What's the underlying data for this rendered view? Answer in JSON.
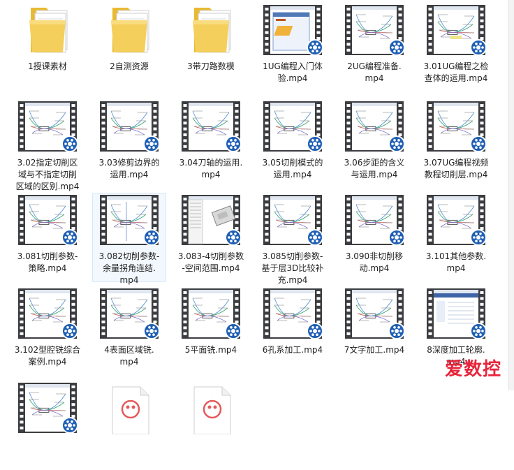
{
  "files": [
    {
      "label": "1授课素材",
      "kind": "folder"
    },
    {
      "label": "2自测资源",
      "kind": "folder"
    },
    {
      "label": "3带刀路数模",
      "kind": "folder"
    },
    {
      "label": "1UG编程入门体\n验.mp4",
      "kind": "video",
      "preview": "dialog"
    },
    {
      "label": "2UG编程准备.\nmp4",
      "kind": "video",
      "preview": "mindmap"
    },
    {
      "label": "3.01UG编程之检\n查体的运用.mp4",
      "kind": "video",
      "preview": "mindmap-light"
    },
    {
      "label": "3.02指定切削区\n域与不指定切削\n区域的区别.mp4",
      "kind": "video",
      "preview": "mindmap"
    },
    {
      "label": "3.03修剪边界的\n运用.mp4",
      "kind": "video",
      "preview": "mindmap"
    },
    {
      "label": "3.04刀轴的运用.\nmp4",
      "kind": "video",
      "preview": "mindmap"
    },
    {
      "label": "3.05切削模式的\n运用.mp4",
      "kind": "video",
      "preview": "mindmap"
    },
    {
      "label": "3.06步距的含义\n与运用.mp4",
      "kind": "video",
      "preview": "mindmap"
    },
    {
      "label": "3.07UG编程视频\n教程切削层.mp4",
      "kind": "video",
      "preview": "mindmap"
    },
    {
      "label": "3.081切削参数-\n策略.mp4",
      "kind": "video",
      "preview": "mindmap"
    },
    {
      "label": "3.082切削参数-\n余量拐角连结.\nmp4",
      "kind": "video",
      "preview": "mindmap-tall",
      "selected": true
    },
    {
      "label": "3.083-4切削参数\n-空间范围.mp4",
      "kind": "video",
      "preview": "model"
    },
    {
      "label": "3.085切削参数-\n基于层3D比较补\n充.mp4",
      "kind": "video",
      "preview": "mindmap"
    },
    {
      "label": "3.090非切削移\n动.mp4",
      "kind": "video",
      "preview": "mindmap"
    },
    {
      "label": "3.101其他参数.\nmp4",
      "kind": "video",
      "preview": "mindmap"
    },
    {
      "label": "3.102型腔铣综合\n案例.mp4",
      "kind": "video",
      "preview": "mindmap"
    },
    {
      "label": "4表面区域铣.\nmp4",
      "kind": "video",
      "preview": "mindmap"
    },
    {
      "label": "5平面铣.mp4",
      "kind": "video",
      "preview": "mindmap"
    },
    {
      "label": "6孔系加工.mp4",
      "kind": "video",
      "preview": "mindmap"
    },
    {
      "label": "7文字加工.mp4",
      "kind": "video",
      "preview": "mindmap"
    },
    {
      "label": "8深度加工轮廓.\nmp4",
      "kind": "video",
      "preview": "screen"
    },
    {
      "label": "",
      "kind": "video",
      "preview": "mindmap"
    },
    {
      "label": "",
      "kind": "pdf"
    },
    {
      "label": "",
      "kind": "pdf"
    }
  ],
  "watermark": "爱数控",
  "colors": {
    "badge": "#1f5fb4",
    "folder": "#f0c84a",
    "film": "#3b3d40"
  }
}
